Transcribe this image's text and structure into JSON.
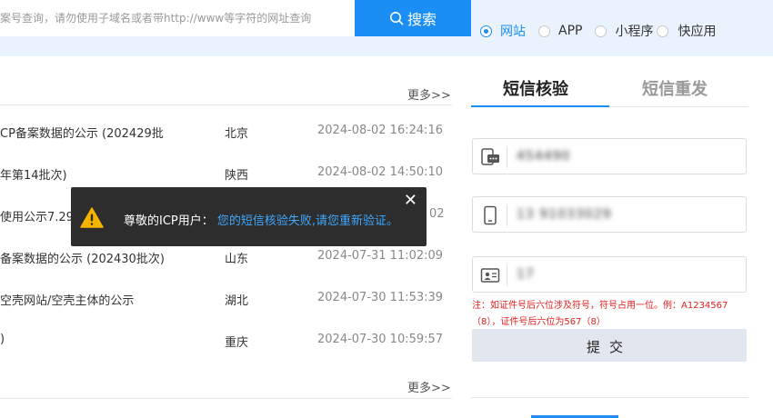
{
  "search": {
    "placeholder": "案号查询，请勿使用子域名或者带http://www等字符的网址查询",
    "button_label": "搜索",
    "types": [
      {
        "label": "网站",
        "checked": true
      },
      {
        "label": "APP",
        "checked": false
      },
      {
        "label": "小程序",
        "checked": false
      },
      {
        "label": "快应用",
        "checked": false
      }
    ]
  },
  "list": {
    "more_label": "更多>>",
    "rows": [
      {
        "title": "CP备案数据的公示 (202429批",
        "province": "北京",
        "date": "2024-08-02 16:24:16"
      },
      {
        "title": "年第14批次)",
        "province": "陕西",
        "date": "2024-08-02 14:50:10"
      },
      {
        "title": "使用公示7.29",
        "province": "",
        "date": "02"
      },
      {
        "title": "备案数据的公示 (202430批次)",
        "province": "山东",
        "date": "2024-07-31 11:02:09"
      },
      {
        "title": "空壳网站/空壳主体的公示",
        "province": "湖北",
        "date": "2024-07-30 11:53:39"
      },
      {
        "title": ")",
        "province": "重庆",
        "date": "2024-07-30 10:59:57"
      }
    ]
  },
  "toast": {
    "prefix": "尊敬的ICP用户：",
    "message": "您的短信核验失败,请您重新验证。",
    "close_label": "✕"
  },
  "panel": {
    "tabs": [
      "短信核验",
      "短信重发"
    ],
    "fields": [
      {
        "value": "454490",
        "icon": "sms-icon"
      },
      {
        "value": "13 91033029",
        "icon": "phone-icon"
      },
      {
        "value": "17",
        "icon": "id-card-icon"
      }
    ],
    "note": "注：如证件号后六位涉及符号，符号占用一位。例：A1234567（8），证件号后六位为567（8）",
    "submit_label": "提交"
  },
  "colors": {
    "accent": "#1a8ef5",
    "toast_bg": "#2d2d2d",
    "note": "#e02020"
  }
}
